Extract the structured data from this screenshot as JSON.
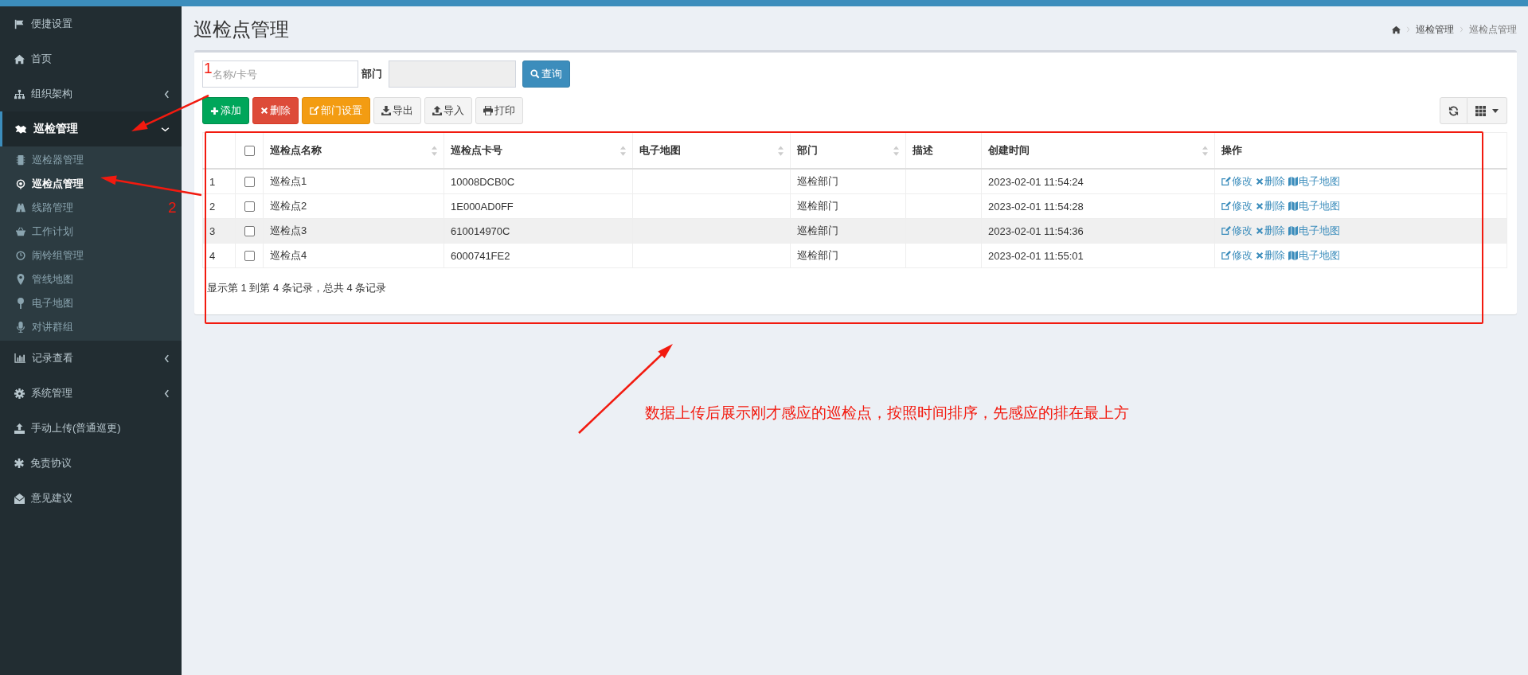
{
  "sidebar": {
    "items": [
      {
        "label": "便捷设置",
        "selected": false
      },
      {
        "label": "首页",
        "selected": false
      },
      {
        "label": "组织架构",
        "selected": false,
        "expanded": false
      },
      {
        "label": "巡检管理",
        "selected": true,
        "expanded": true,
        "children": [
          {
            "label": "巡检器管理",
            "selected": false
          },
          {
            "label": "巡检点管理",
            "selected": true
          },
          {
            "label": "线路管理",
            "selected": false
          },
          {
            "label": "工作计划",
            "selected": false
          },
          {
            "label": "闹铃组管理",
            "selected": false
          },
          {
            "label": "管线地图",
            "selected": false
          },
          {
            "label": "电子地图",
            "selected": false
          },
          {
            "label": "对讲群组",
            "selected": false
          }
        ]
      },
      {
        "label": "记录查看",
        "selected": false,
        "expanded": false
      },
      {
        "label": "系统管理",
        "selected": false,
        "expanded": false
      },
      {
        "label": "手动上传(普通巡更)",
        "selected": false
      },
      {
        "label": "免责协议",
        "selected": false
      },
      {
        "label": "意见建议",
        "selected": false
      }
    ]
  },
  "page": {
    "title": "巡检点管理",
    "breadcrumb": [
      "巡检管理",
      "巡检点管理"
    ]
  },
  "filters": {
    "search": {
      "placeholder": "名称/卡号"
    },
    "department_label": "部门",
    "query_button": "查询"
  },
  "actions": [
    {
      "label": "添加",
      "kind": "success"
    },
    {
      "label": "删除",
      "kind": "danger"
    },
    {
      "label": "部门设置",
      "kind": "warning"
    },
    {
      "label": "导出",
      "kind": "default"
    },
    {
      "label": "导入",
      "kind": "default"
    },
    {
      "label": "打印",
      "kind": "default"
    }
  ],
  "table": {
    "header_checked": false,
    "columns": [
      {
        "label": "巡检点名称",
        "sortable": true
      },
      {
        "label": "巡检点卡号",
        "sortable": true
      },
      {
        "label": "电子地图",
        "sortable": true
      },
      {
        "label": "部门",
        "sortable": true
      },
      {
        "label": "描述",
        "sortable": false
      },
      {
        "label": "创建时间",
        "sortable": true
      },
      {
        "label": "操作",
        "sortable": false
      }
    ],
    "rows": [
      {
        "index": "1",
        "checked": false,
        "highlighted": false,
        "name": "巡检点1",
        "card_no": "10008DCB0C",
        "department": "巡检部门",
        "created_at": "2023-02-01 11:54:24",
        "actions": [
          "修改",
          "删除",
          "电子地图"
        ]
      },
      {
        "index": "2",
        "checked": false,
        "highlighted": false,
        "name": "巡检点2",
        "card_no": "1E000AD0FF",
        "department": "巡检部门",
        "created_at": "2023-02-01 11:54:28",
        "actions": [
          "修改",
          "删除",
          "电子地图"
        ]
      },
      {
        "index": "3",
        "checked": false,
        "highlighted": true,
        "name": "巡检点3",
        "card_no": "610014970C",
        "department": "巡检部门",
        "created_at": "2023-02-01 11:54:36",
        "actions": [
          "修改",
          "删除",
          "电子地图"
        ]
      },
      {
        "index": "4",
        "checked": false,
        "highlighted": false,
        "name": "巡检点4",
        "card_no": "6000741FE2",
        "department": "巡检部门",
        "created_at": "2023-02-01 11:55:01",
        "actions": [
          "修改",
          "删除",
          "电子地图"
        ]
      }
    ],
    "footer": "显示第 1 到第 4 条记录，总共 4 条记录"
  },
  "annotations": {
    "markers": [
      "1",
      "2"
    ],
    "note": "数据上传后展示刚才感应的巡检点，按照时间排序，先感应的排在最上方"
  }
}
